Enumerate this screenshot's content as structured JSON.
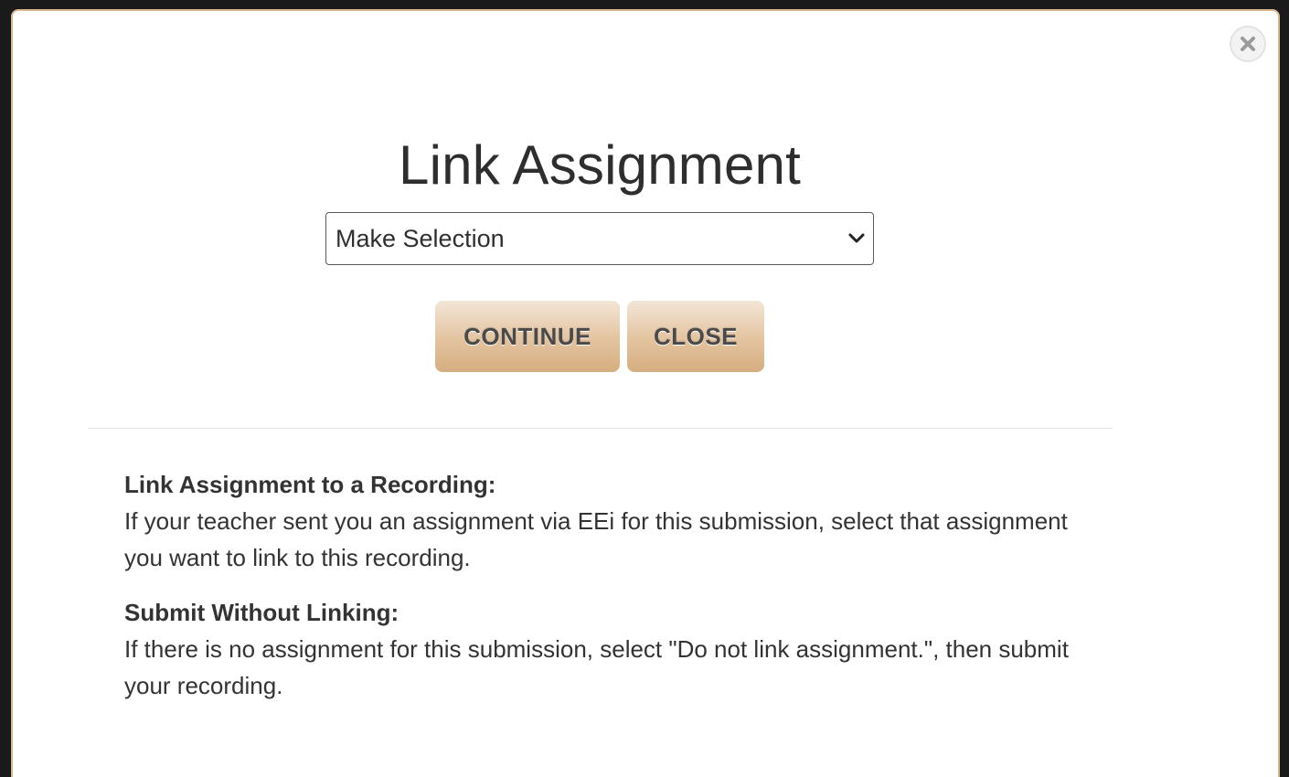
{
  "modal": {
    "title": "Link Assignment",
    "close_icon": "close-x-icon",
    "select": {
      "selected_value": "Make Selection",
      "icon": "chevron-down-icon"
    },
    "buttons": {
      "continue_label": "CONTINUE",
      "close_label": "CLOSE"
    },
    "sections": [
      {
        "heading": "Link Assignment to a Recording:",
        "body": "If your teacher sent you an assignment via EEi for this submission, select that assignment you want to link to this recording."
      },
      {
        "heading": "Submit Without Linking:",
        "body": "If there is no assignment for this submission, select \"Do not link assignment.\", then submit your recording."
      }
    ]
  },
  "colors": {
    "modal_border": "#d8b48a",
    "button_gradient_top": "#f3e6d6",
    "button_gradient_bottom": "#d6ae80",
    "text": "#333333"
  }
}
